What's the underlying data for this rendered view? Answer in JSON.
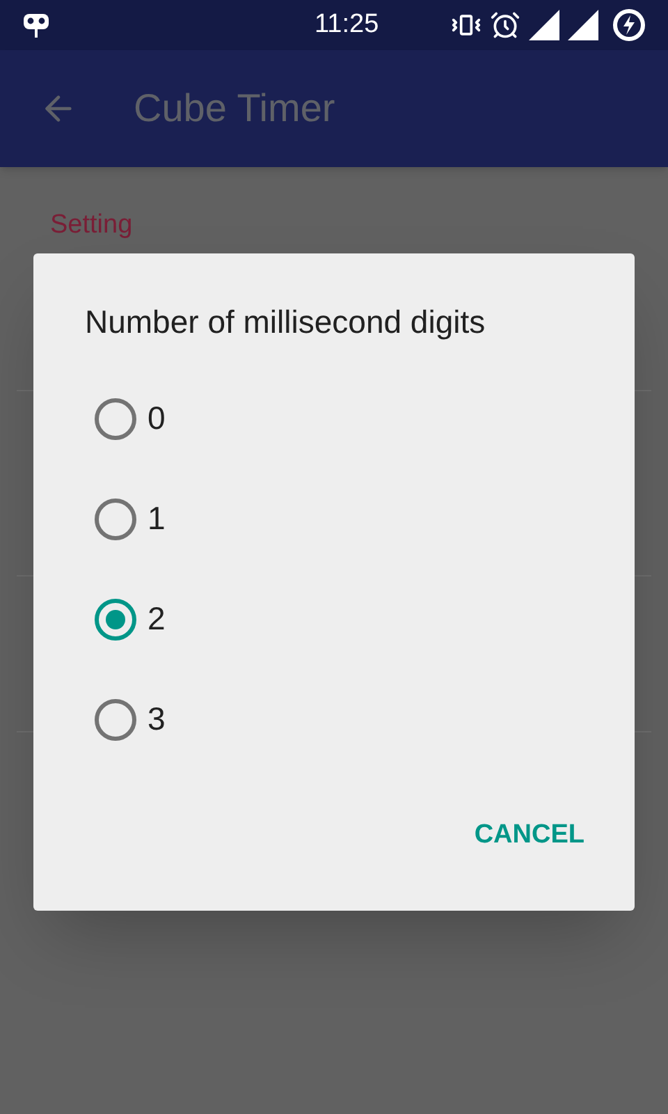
{
  "status_bar": {
    "time": "11:25"
  },
  "app_bar": {
    "title": "Cube Timer"
  },
  "settings": {
    "section_title": "Setting"
  },
  "dialog": {
    "title": "Number of millisecond digits",
    "options": [
      {
        "label": "0",
        "selected": false
      },
      {
        "label": "1",
        "selected": false
      },
      {
        "label": "2",
        "selected": true
      },
      {
        "label": "3",
        "selected": false
      }
    ],
    "buttons": [
      "CANCEL"
    ]
  }
}
